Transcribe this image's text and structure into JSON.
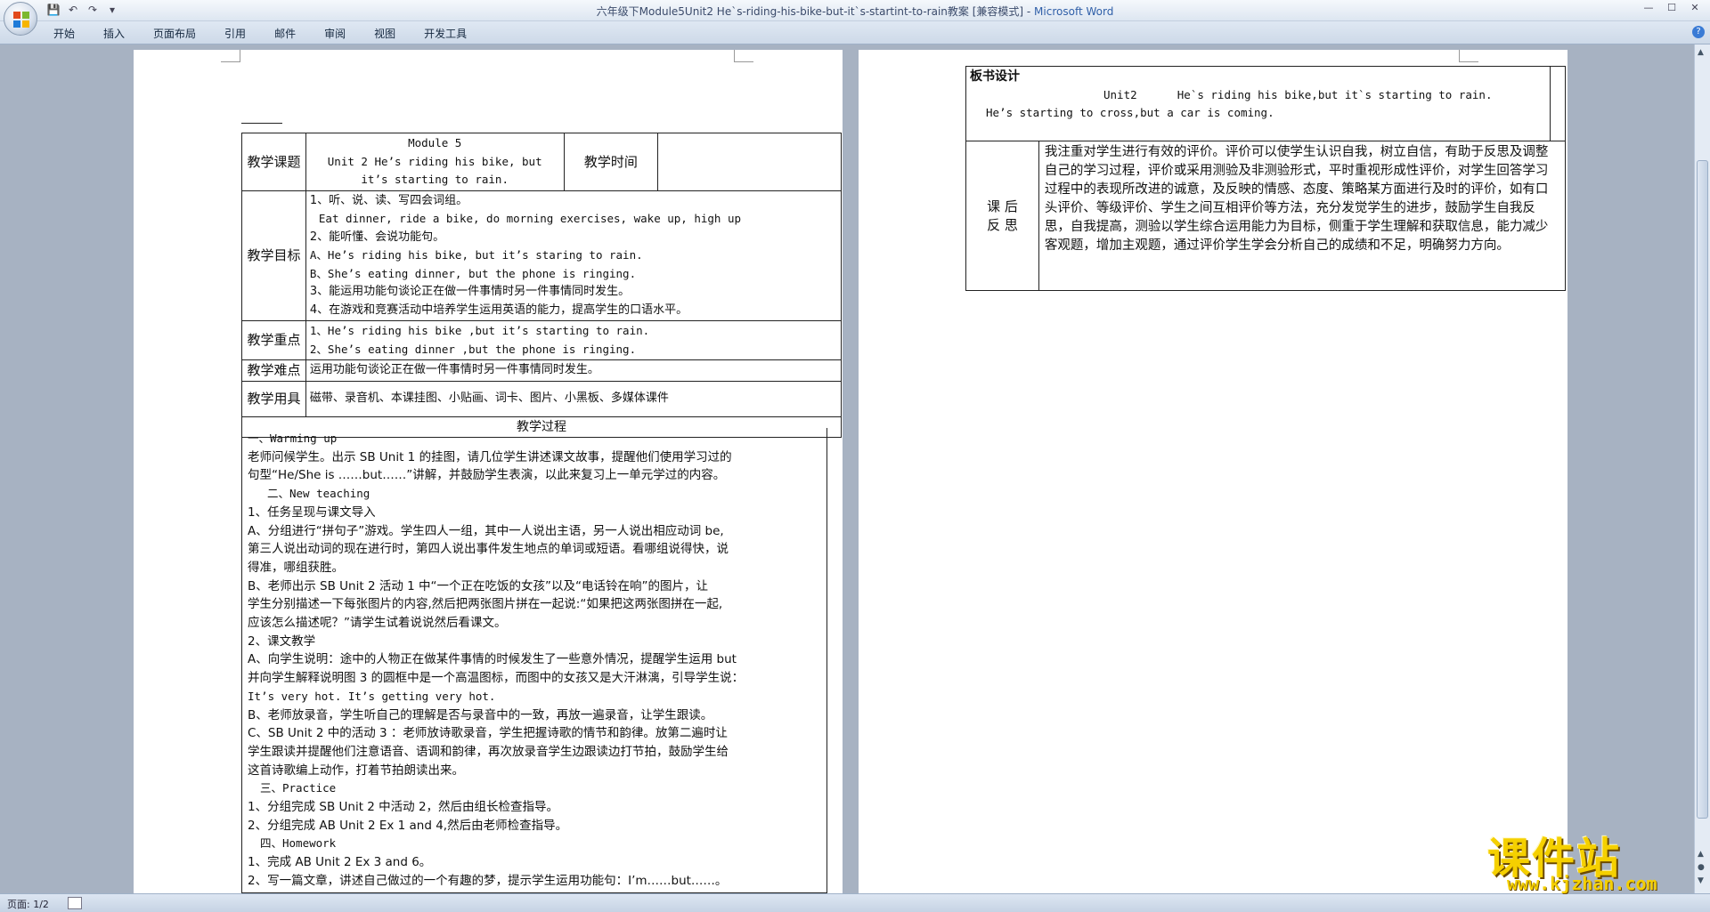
{
  "window": {
    "title": "六年级下Module5Unit2 He`s-riding-his-bike-but-it`s-startint-to-rain教案 [兼容模式]",
    "separator": " - ",
    "app_name": "Microsoft Word"
  },
  "ribbon": {
    "tabs": [
      "开始",
      "插入",
      "页面布局",
      "引用",
      "邮件",
      "审阅",
      "视图",
      "开发工具"
    ]
  },
  "page1": {
    "header_rows": {
      "topic_label": "教学课题",
      "topic_line1": "Module 5",
      "topic_line2": "Unit 2 He’s riding his bike, but",
      "topic_line3": "it’s starting to rain.",
      "time_label": "教学时间",
      "goal_label": "教学目标",
      "goals": [
        "1、听、说、读、写四会词组。",
        "Eat dinner, ride a bike, do morning exercises, wake up, high up",
        "2、能听懂、会说功能句。",
        "A、He’s riding his bike, but it’s staring to rain.",
        "B、She’s eating dinner, but the phone is ringing.",
        "3、能运用功能句谈论正在做一件事情时另一件事情同时发生。",
        "4、在游戏和竞赛活动中培养学生运用英语的能力，提高学生的口语水平。"
      ],
      "key_label": "教学重点",
      "keys": [
        "1、He’s riding his bike ,but it’s starting to rain.",
        "2、She’s eating dinner ,but the phone is ringing."
      ],
      "difficulty_label": "教学难点",
      "difficulty": "运用功能句谈论正在做一件事情时另一件事情同时发生。",
      "tools_label": "教学用具",
      "tools": "磁带、录音机、本课挂图、小贴画、词卡、图片、小黑板、多媒体课件",
      "process_label": "教学过程"
    },
    "process": [
      "一、Warming up",
      "老师问候学生。出示 SB Unit 1 的挂图，请几位学生讲述课文故事，提醒他们使用学习过的",
      "句型“He/She is ……but……”讲解，并鼓励学生表演，以此来复习上一单元学过的内容。",
      "二、New teaching",
      "1、任务呈现与课文导入",
      "A、分组进行“拼句子”游戏。学生四人一组，其中一人说出主语，另一人说出相应动词 be,",
      "第三人说出动词的现在进行时，第四人说出事件发生地点的单词或短语。看哪组说得快，说",
      "得准，哪组获胜。",
      "B、老师出示 SB Unit 2 活动 1 中“一个正在吃饭的女孩”以及“电话铃在响”的图片，让",
      "学生分别描述一下每张图片的内容,然后把两张图片拼在一起说:“如果把这两张图拼在一起,",
      "应该怎么描述呢？”请学生试着说说然后看课文。",
      "2、课文教学",
      "A、向学生说明：途中的人物正在做某件事情的时候发生了一些意外情况，提醒学生运用 but",
      "并向学生解释说明图 3 的圆框中是一个高温图标，而图中的女孩又是大汗淋漓，引导学生说：",
      "It’s very hot. It’s getting very hot.",
      "B、老师放录音，学生听自己的理解是否与录音中的一致，再放一遍录音，让学生跟读。",
      "C、SB Unit 2 中的活动 3 ：老师放诗歌录音，学生把握诗歌的情节和韵律。放第二遍时让",
      "学生跟读并提醒他们注意语音、语调和韵律，再次放录音学生边跟读边打节拍，鼓励学生给",
      "这首诗歌编上动作，打着节拍朗读出来。",
      "三、Practice",
      "1、分组完成 SB Unit 2 中活动 2，然后由组长检查指导。",
      "2、分组完成 AB Unit 2 Ex 1 and 4,然后由老师检查指导。",
      "四、Homework",
      "1、完成 AB Unit 2 Ex 3 and 6。",
      "2、写一篇文章，讲述自己做过的一个有趣的梦，提示学生运用功能句：I’m……but……。"
    ]
  },
  "page2": {
    "board_label": "板书设计",
    "board_line1": "Unit2      He`s riding his bike,but it`s starting to rain.",
    "board_line2": "He’s starting to cross,but a car is coming.",
    "reflection_label_1": "课  后",
    "reflection_label_2": "反  思",
    "reflection": "我注重对学生进行有效的评价。评价可以使学生认识自我，树立自信，有助于反思及调整自己的学习过程，评价或采用测验及非测验形式，平时重视形成性评价，对学生回答学习过程中的表现所改进的诚意，及反映的情感、态度、策略某方面进行及时的评价，如有口头评价、等级评价、学生之间互相评价等方法，充分发觉学生的进步，鼓励学生自我反思，自我提高，测验以学生综合运用能力为目标，侧重于学生理解和获取信息，能力减少客观题，增加主观题，通过评价学生学会分析自己的成绩和不足，明确努力方向。"
  },
  "status_bar": {
    "page_indicator": "页面: 1/2"
  },
  "watermark": {
    "text": "课件站",
    "url": "www.kjzhan.com"
  },
  "colors": {
    "app_title": "#2f5fa8",
    "workspace": "#a7b2c2",
    "watermark": "#f5d000"
  }
}
